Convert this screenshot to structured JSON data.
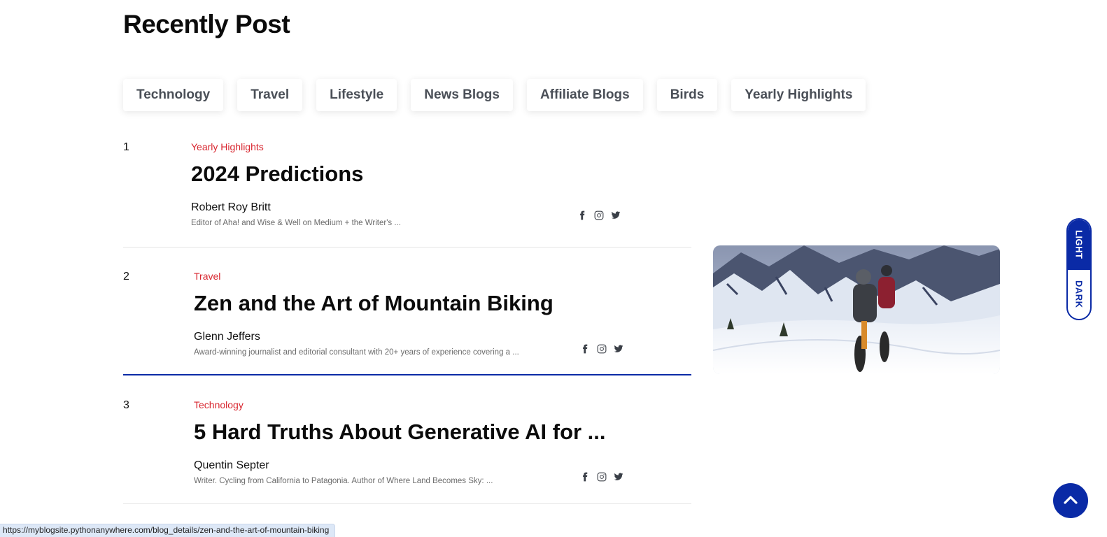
{
  "section": {
    "title": "Recently Post"
  },
  "categories": [
    "Technology",
    "Travel",
    "Lifestyle",
    "News Blogs",
    "Affiliate Blogs",
    "Birds",
    "Yearly Highlights"
  ],
  "posts": [
    {
      "number": "1",
      "category": "Yearly Highlights",
      "title": "2024 Predictions",
      "author": "Robert Roy Britt",
      "bio": "Editor of Aha! and Wise & Well on Medium + the Writer's ..."
    },
    {
      "number": "2",
      "category": "Travel",
      "title": "Zen and the Art of Mountain Biking",
      "author": "Glenn Jeffers",
      "bio": "Award-winning journalist and editorial consultant with 20+ years of experience covering a ..."
    },
    {
      "number": "3",
      "category": "Technology",
      "title": "5 Hard Truths About Generative AI for ...",
      "author": "Quentin Septer",
      "bio": "Writer. Cycling from California to Patagonia. Author of Where Land Becomes Sky: ..."
    }
  ],
  "socials": [
    "facebook-icon",
    "instagram-icon",
    "twitter-icon"
  ],
  "theme_toggle": {
    "light": "LIGHT",
    "dark": "DARK"
  },
  "status_bar": {
    "url": "https://myblogsite.pythonanywhere.com/blog_details/zen-and-the-art-of-mountain-biking"
  },
  "colors": {
    "accent": "#0a2aa6",
    "category_red": "#d8262f"
  }
}
